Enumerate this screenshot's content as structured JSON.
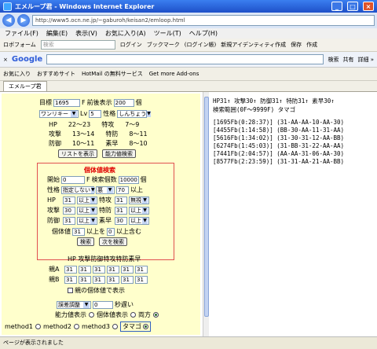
{
  "window": {
    "title": "エメループ君 - Windows Internet Explorer"
  },
  "address": {
    "url": "http://www5.ocn.ne.jp/~gaburoh/keisan2/emloop.html"
  },
  "menu": [
    "ファイル(F)",
    "編集(E)",
    "表示(V)",
    "お気に入り(A)",
    "ツール(T)",
    "ヘルプ(H)"
  ],
  "toolbar": {
    "logo": "ロボフォーム",
    "search_placeholder": "検索",
    "login": "ログイン",
    "bookmark": "ブックマーク",
    "login2": "(ログイン帳)",
    "identity": "新規アイデンティティ作成",
    "save": "保存",
    "create": "作成"
  },
  "google": {
    "logo": "Google",
    "search": "検索",
    "share": "共有",
    "more": "詳細 »"
  },
  "favbar": {
    "fav": "お気に入り",
    "recommended": "おすすめサイト",
    "hotmail": "HotMail の無料サービス",
    "addons": "Get more Add-ons"
  },
  "tab": {
    "label": "エメループ君"
  },
  "form": {
    "goal_label": "目標",
    "goal_value": "1695",
    "f_label": "F",
    "prev_label": "前後表示",
    "prev_value": "200",
    "count_unit": "個",
    "pokemon": "ワンリキー",
    "lv_label": "Lv",
    "lv_value": "5",
    "nature_label": "性格",
    "nature": "しんちょう",
    "stats": [
      {
        "label": "HP",
        "range": "22〜23",
        "label2": "特攻",
        "range2": "7〜9"
      },
      {
        "label": "攻撃",
        "range": "13〜14",
        "label2": "特防",
        "range2": "8〜11"
      },
      {
        "label": "防御",
        "range": "10〜11",
        "label2": "素早",
        "range2": "8〜10"
      }
    ],
    "list_btn": "リストを表示",
    "ability_btn": "能力値検索"
  },
  "kotai": {
    "title": "個体値検索",
    "start_label": "開始",
    "start_value": "0",
    "f_label": "F",
    "count_label": "検索個数",
    "count_value": "10000",
    "count_unit": "個",
    "nature_label": "性格",
    "nature_value": "指定しない",
    "gender_value": "悪",
    "over_value": "70",
    "over_label": "以上",
    "rows": [
      {
        "label": "HP",
        "value": "31",
        "cond": "以上",
        "label2": "特攻",
        "value2": "31",
        "cond2": "無視"
      },
      {
        "label": "攻撃",
        "value": "30",
        "cond": "以上",
        "label2": "特防",
        "value2": "31",
        "cond2": "以上"
      },
      {
        "label": "防御",
        "value": "31",
        "cond": "以上",
        "label2": "素早",
        "value2": "30",
        "cond2": "以上"
      }
    ],
    "sum_label": "個体値",
    "sum_value": "31",
    "sum_mid": "以上を",
    "sum_value2": "0",
    "sum_end": "以上含む",
    "search_btn": "検索",
    "next_btn": "次を検索"
  },
  "parents": {
    "header": "HP 攻撃防御特攻特防素早",
    "a_label": "親A",
    "b_label": "親B",
    "a_values": [
      "31",
      "31",
      "31",
      "31",
      "31",
      "31"
    ],
    "b_values": [
      "31",
      "31",
      "31",
      "31",
      "31",
      "31"
    ],
    "show_label": "親の個体値で表示"
  },
  "bottom": {
    "adjust": "誤差調整",
    "adjust_value": "0",
    "delay": "秒遅い",
    "ability_label": "能力値表示",
    "indiv_label": "個体値表示",
    "both_label": "両方",
    "m1": "method1",
    "m2": "method2",
    "m3": "method3",
    "tamago": "タマゴ"
  },
  "results": {
    "line1": "HP31↑ 攻撃30↑ 防御31↑ 特防31↑ 素早30↑",
    "line2": "検索範囲(0F〜9999F) タマゴ",
    "items": [
      "[1695Fb(0:28:37)] (31-AA-AA-10-AA-30)",
      "[4455Fb(1:14:58)] (BB-30-AA-11-31-AA)",
      "[5616Fb(1:34:02)] (31-30-31-12-AA-BB)",
      "[6274Fb(1:45:03)] (31-BB-31-22-AA-AA)",
      "[7441Fb(2:04:57)] (AA-AA-31-06-AA-30)",
      "[8577Fb(2:23:59)] (31-31-AA-21-AA-BB)"
    ]
  },
  "status": "ページが表示されました"
}
